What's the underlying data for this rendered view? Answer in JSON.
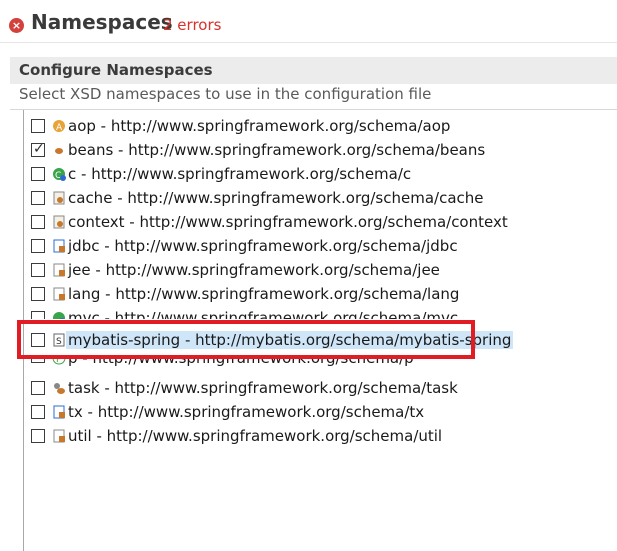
{
  "header": {
    "title": "Namespaces",
    "errors": "2 errors",
    "error_icon": "error-icon",
    "error_color": "#d9312b"
  },
  "section": {
    "title": "Configure Namespaces",
    "description": "Select XSD namespaces to use in the configuration file"
  },
  "namespaces": [
    {
      "label": "aop - http://www.springframework.org/schema/aop",
      "checked": false,
      "icon": "aop-icon"
    },
    {
      "label": "beans - http://www.springframework.org/schema/beans",
      "checked": true,
      "icon": "bean-icon"
    },
    {
      "label": "c - http://www.springframework.org/schema/c",
      "checked": false,
      "icon": "c-namespace-icon"
    },
    {
      "label": "cache - http://www.springframework.org/schema/cache",
      "checked": false,
      "icon": "cache-icon"
    },
    {
      "label": "context - http://www.springframework.org/schema/context",
      "checked": false,
      "icon": "context-icon"
    },
    {
      "label": "jdbc - http://www.springframework.org/schema/jdbc",
      "checked": false,
      "icon": "jdbc-icon"
    },
    {
      "label": "jee - http://www.springframework.org/schema/jee",
      "checked": false,
      "icon": "jee-icon"
    },
    {
      "label": "lang - http://www.springframework.org/schema/lang",
      "checked": false,
      "icon": "lang-icon"
    },
    {
      "label": "mvc - http://www.springframework.org/schema/mvc",
      "checked": false,
      "icon": "mvc-icon"
    },
    {
      "label": "mybatis-spring - http://mybatis.org/schema/mybatis-spring",
      "checked": false,
      "icon": "schema-icon",
      "selected": true
    },
    {
      "label": "p - http://www.springframework.org/schema/p",
      "checked": false,
      "icon": "p-namespace-icon"
    },
    {
      "label": "task - http://www.springframework.org/schema/task",
      "checked": false,
      "icon": "task-icon"
    },
    {
      "label": "tx - http://www.springframework.org/schema/tx",
      "checked": false,
      "icon": "tx-icon"
    },
    {
      "label": "util - http://www.springframework.org/schema/util",
      "checked": false,
      "icon": "util-icon"
    }
  ]
}
